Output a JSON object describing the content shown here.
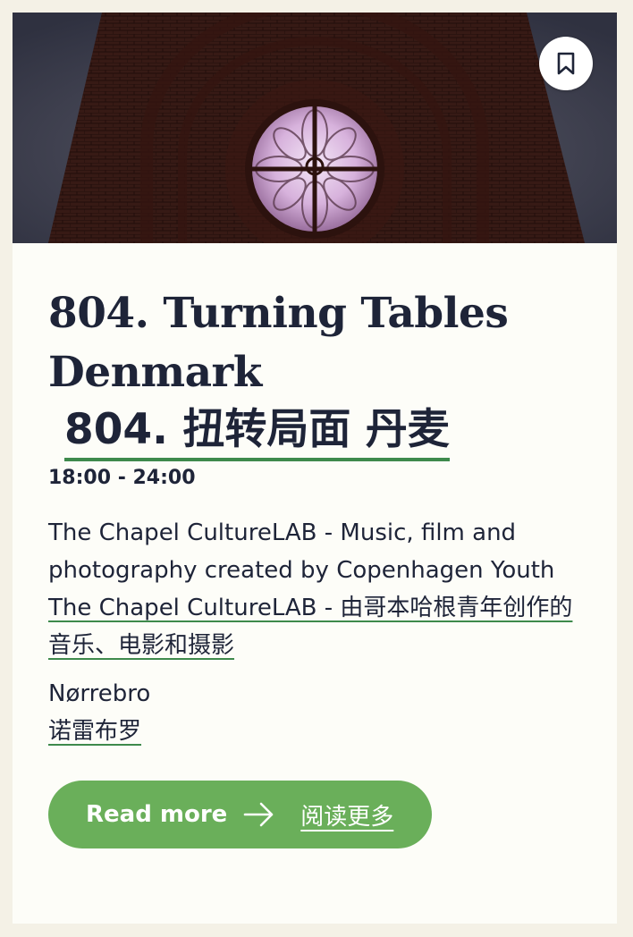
{
  "card": {
    "title_en": "804. Turning Tables Denmark",
    "title_cn": "804. 扭转局面 丹麦",
    "time": "18:00 - 24:00",
    "description_en": "The Chapel CultureLAB - Music, film and photography created by Copenhagen Youth",
    "description_cn": "The Chapel CultureLAB - 由哥本哈根青年创作的音乐、电影和摄影",
    "location_en": "Nørrebro",
    "location_cn": "诺雷布罗",
    "read_more_label": "Read more",
    "read_more_cn": "阅读更多"
  },
  "icons": {
    "bookmark": "bookmark-icon",
    "arrow": "arrow-right-icon"
  },
  "colors": {
    "page_bg": "#f4f1e6",
    "card_bg": "#fdfdf8",
    "text": "#1e2438",
    "accent_green": "#6aaf5a",
    "underline_green": "#3e8a4c"
  }
}
